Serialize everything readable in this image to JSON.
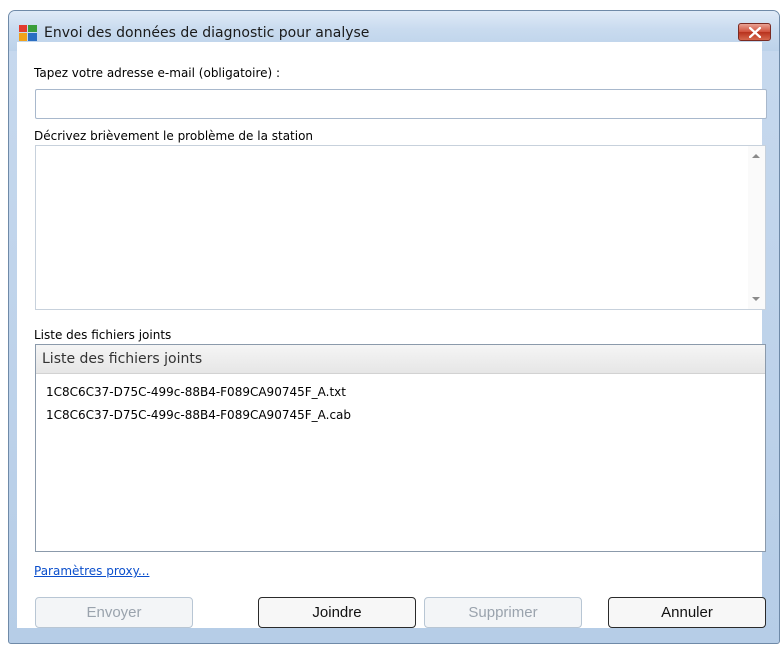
{
  "window": {
    "title": "Envoi des données de diagnostic pour analyse",
    "close_icon": "close-icon",
    "app_icon": "avg-logo-icon"
  },
  "email": {
    "label": "Tapez votre adresse e-mail (obligatoire) :",
    "value": "",
    "placeholder": ""
  },
  "description": {
    "label": "Décrivez brièvement le problème de la station",
    "value": ""
  },
  "attachments": {
    "label": "Liste des fichiers joints",
    "column_header": "Liste des fichiers joints",
    "files": [
      "1C8C6C37-D75C-499c-88B4-F089CA90745F_A.txt",
      "1C8C6C37-D75C-499c-88B4-F089CA90745F_A.cab"
    ]
  },
  "proxy_link": "Paramètres proxy...",
  "buttons": {
    "send": "Envoyer",
    "attach": "Joindre",
    "delete": "Supprimer",
    "cancel": "Annuler"
  },
  "colors": {
    "link": "#0b4fcc",
    "close_button": "#c9432b",
    "frame": "#b6cde7"
  }
}
